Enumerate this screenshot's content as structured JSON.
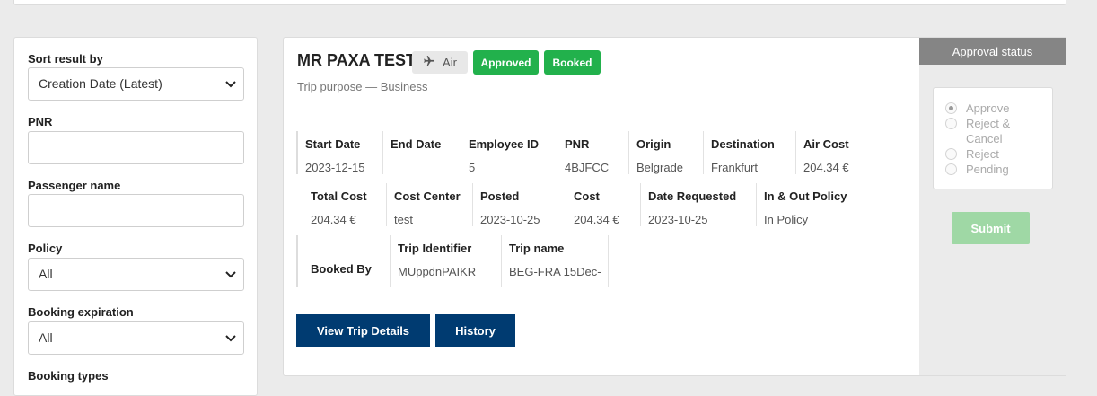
{
  "filters": {
    "sort_label": "Sort result by",
    "sort_value": "Creation Date (Latest)",
    "pnr_label": "PNR",
    "pnr_value": "",
    "passenger_label": "Passenger name",
    "passenger_value": "",
    "policy_label": "Policy",
    "policy_value": "All",
    "expiration_label": "Booking expiration",
    "expiration_value": "All",
    "types_label": "Booking types"
  },
  "trip": {
    "name": "MR PAXA TEST",
    "type_label": "Air",
    "status_approved": "Approved",
    "status_booked": "Booked",
    "purpose": "Trip purpose — Business",
    "row1": [
      {
        "label": "Start Date",
        "value": "2023-12-15"
      },
      {
        "label": "End Date",
        "value": ""
      },
      {
        "label": "Employee ID",
        "value": "5"
      },
      {
        "label": "PNR",
        "value": "4BJFCC"
      },
      {
        "label": "Origin",
        "value": "Belgrade"
      },
      {
        "label": "Destination",
        "value": "Frankfurt"
      },
      {
        "label": "Air Cost",
        "value": "204.34 €"
      }
    ],
    "row2": [
      {
        "label": "Total Cost",
        "value": "204.34 €"
      },
      {
        "label": "Cost Center",
        "value": "test"
      },
      {
        "label": "Posted",
        "value": "2023-10-25"
      },
      {
        "label": "Cost",
        "value": "204.34 €"
      },
      {
        "label": "Date Requested",
        "value": "2023-10-25"
      },
      {
        "label": "In & Out Policy",
        "value": "In Policy"
      }
    ],
    "row3": [
      {
        "label": "Booked By",
        "value": ""
      },
      {
        "label": "Trip Identifier",
        "value": "MUppdnPAIKR"
      },
      {
        "label": "Trip name",
        "value": "BEG-FRA 15Dec-"
      }
    ],
    "view_details_label": "View Trip Details",
    "history_label": "History"
  },
  "approval": {
    "title": "Approval status",
    "options": [
      "Approve",
      "Reject & Cancel",
      "Reject",
      "Pending"
    ],
    "selected": "Approve",
    "submit_label": "Submit"
  },
  "colors": {
    "primary": "#003b71",
    "success": "#22b14c",
    "submit_disabled": "#9fd8a5",
    "panel_header": "#858585"
  },
  "icons": {
    "trip_type": "airplane-icon",
    "select_arrow": "chevron-down-icon"
  }
}
